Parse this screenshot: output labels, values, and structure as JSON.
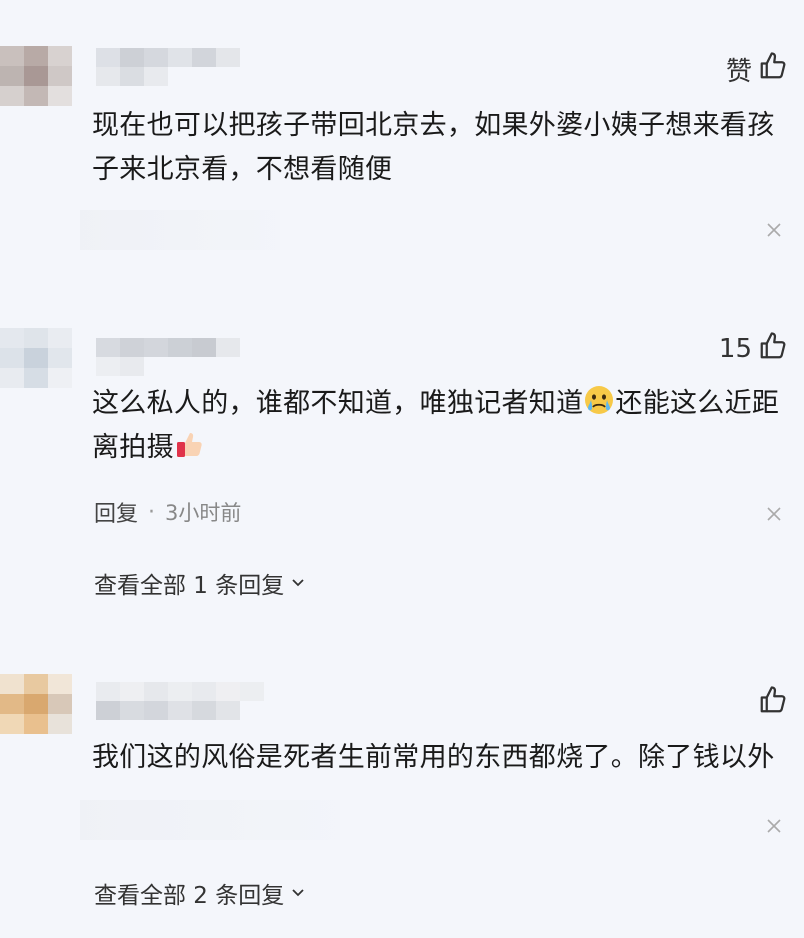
{
  "comments": [
    {
      "like_label": "赞",
      "text": "现在也可以把孩子带回北京去，如果外婆小姨子想来看孩子来北京看，不想看随便"
    },
    {
      "like_label": "15",
      "text_part1": "这么私人的，谁都不知道，唯独记者知道",
      "text_part2": "还能这么近距离拍摄",
      "reply_label": "回复",
      "separator": "·",
      "time": "3小时前",
      "view_replies": "查看全部 1 条回复"
    },
    {
      "text": "我们这的风俗是死者生前常用的东西都烧了。除了钱以外",
      "view_replies": "查看全部 2 条回复"
    }
  ],
  "icons": {
    "like": "thumbs-up-icon",
    "close": "close-icon",
    "chevron": "chevron-down-icon",
    "crying_face": "crying-face-emoji",
    "thumbs_up_emoji": "thumbs-up-emoji"
  }
}
